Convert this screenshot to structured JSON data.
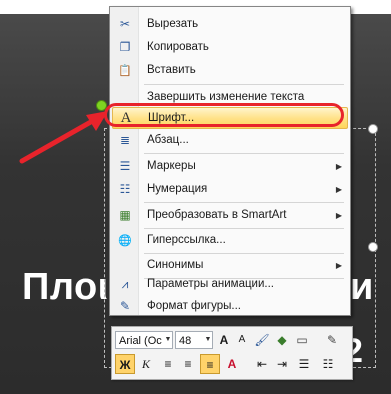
{
  "slide": {
    "title_fragment": "Плоι",
    "title_suffix": "и",
    "number_fragment": "2"
  },
  "context_menu": {
    "items": [
      {
        "label": "Вырезать",
        "icon": "scissors-icon",
        "glyph": "✂"
      },
      {
        "label": "Копировать",
        "icon": "copy-icon",
        "glyph": "❐"
      },
      {
        "label": "Вставить",
        "icon": "paste-icon",
        "glyph": "📋"
      },
      {
        "label": "Завершить изменение текста",
        "icon": "",
        "glyph": ""
      },
      {
        "label": "Шрифт...",
        "icon": "font-icon",
        "glyph": "A"
      },
      {
        "label": "Абзац...",
        "icon": "paragraph-icon",
        "glyph": "≣"
      },
      {
        "label": "Маркеры",
        "icon": "bullets-icon",
        "glyph": "☰"
      },
      {
        "label": "Нумерация",
        "icon": "numbering-icon",
        "glyph": "☷"
      },
      {
        "label": "Преобразовать в SmartArt",
        "icon": "smartart-icon",
        "glyph": "▦"
      },
      {
        "label": "Гиперссылка...",
        "icon": "hyperlink-icon",
        "glyph": "🌐"
      },
      {
        "label": "Синонимы",
        "icon": "",
        "glyph": ""
      },
      {
        "label": "Параметры анимации...",
        "icon": "animation-icon",
        "glyph": "⩘"
      },
      {
        "label": "Формат фигуры...",
        "icon": "format-shape-icon",
        "glyph": "✎"
      }
    ]
  },
  "mini_toolbar": {
    "font_name": "Arial (Ос",
    "font_size": "48",
    "grow_font": "A",
    "shrink_font": "A",
    "bold": "Ж",
    "italic": "К",
    "font_color": "A"
  },
  "colors": {
    "highlight": "#ffd65a",
    "callout_red": "#e8232b",
    "slide_bg": "#333333",
    "text_white": "#ffffff"
  }
}
